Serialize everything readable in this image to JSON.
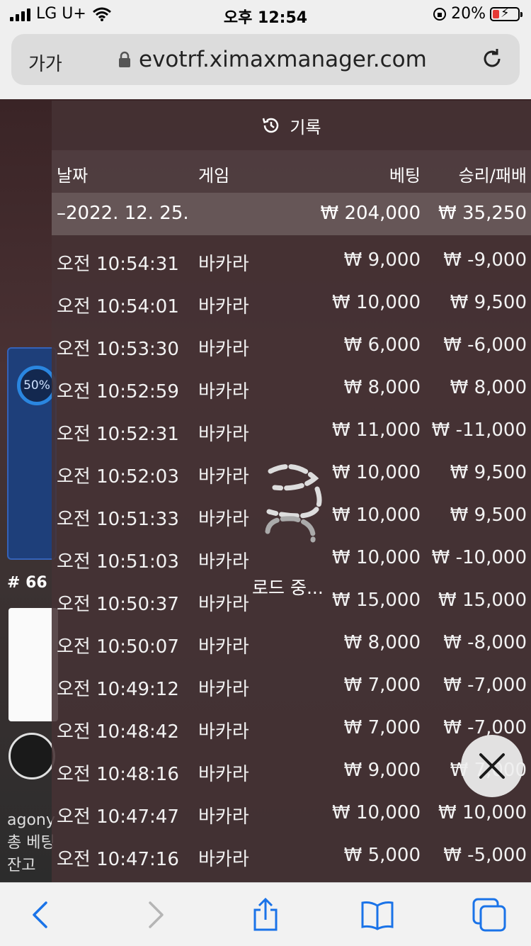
{
  "status_bar": {
    "carrier": "LG U+",
    "time": "오후 12:54",
    "battery": "20%"
  },
  "browser": {
    "text_size_label": "가가",
    "url": "evotrf.ximaxmanager.com"
  },
  "background": {
    "percent": "50%",
    "room_number": "# 66",
    "username": "agony",
    "total_bet_label": "총 베팅",
    "balance_label": "잔고"
  },
  "history": {
    "title": "기록",
    "columns": {
      "date": "날짜",
      "game": "게임",
      "bet": "베팅",
      "win_loss": "승리/패배"
    },
    "date_group": {
      "date": "–2022. 12. 25.",
      "bet": "₩ 204,000",
      "win_loss": "₩ 35,250"
    },
    "rows": [
      {
        "time": "오전 10:54:31",
        "game": "바카라",
        "bet": "₩ 9,000",
        "win_loss": "₩ -9,000"
      },
      {
        "time": "오전 10:54:01",
        "game": "바카라",
        "bet": "₩ 10,000",
        "win_loss": "₩ 9,500"
      },
      {
        "time": "오전 10:53:30",
        "game": "바카라",
        "bet": "₩ 6,000",
        "win_loss": "₩ -6,000"
      },
      {
        "time": "오전 10:52:59",
        "game": "바카라",
        "bet": "₩ 8,000",
        "win_loss": "₩ 8,000"
      },
      {
        "time": "오전 10:52:31",
        "game": "바카라",
        "bet": "₩ 11,000",
        "win_loss": "₩ -11,000"
      },
      {
        "time": "오전 10:52:03",
        "game": "바카라",
        "bet": "₩ 10,000",
        "win_loss": "₩ 9,500"
      },
      {
        "time": "오전 10:51:33",
        "game": "바카라",
        "bet": "₩ 10,000",
        "win_loss": "₩ 9,500"
      },
      {
        "time": "오전 10:51:03",
        "game": "바카라",
        "bet": "₩ 10,000",
        "win_loss": "₩ -10,000"
      },
      {
        "time": "오전 10:50:37",
        "game": "바카라",
        "bet": "₩ 15,000",
        "win_loss": "₩ 15,000"
      },
      {
        "time": "오전 10:50:07",
        "game": "바카라",
        "bet": "₩ 8,000",
        "win_loss": "₩ -8,000"
      },
      {
        "time": "오전 10:49:12",
        "game": "바카라",
        "bet": "₩ 7,000",
        "win_loss": "₩ -7,000"
      },
      {
        "time": "오전 10:48:42",
        "game": "바카라",
        "bet": "₩ 7,000",
        "win_loss": "₩ -7,000"
      },
      {
        "time": "오전 10:48:16",
        "game": "바카라",
        "bet": "₩ 9,000",
        "win_loss": "₩ 7,000"
      },
      {
        "time": "오전 10:47:47",
        "game": "바카라",
        "bet": "₩ 10,000",
        "win_loss": "₩ 10,000"
      },
      {
        "time": "오전 10:47:16",
        "game": "바카라",
        "bet": "₩ 5,000",
        "win_loss": "₩ -5,000"
      }
    ],
    "loading_text": "로드 중..."
  },
  "icons": {
    "history": "history-icon",
    "lock": "lock-icon",
    "reload": "reload-icon",
    "close": "close-icon",
    "back": "back-arrow-icon",
    "forward": "forward-arrow-icon",
    "share": "share-icon",
    "bookmarks": "bookmarks-icon",
    "tabs": "tabs-icon"
  }
}
